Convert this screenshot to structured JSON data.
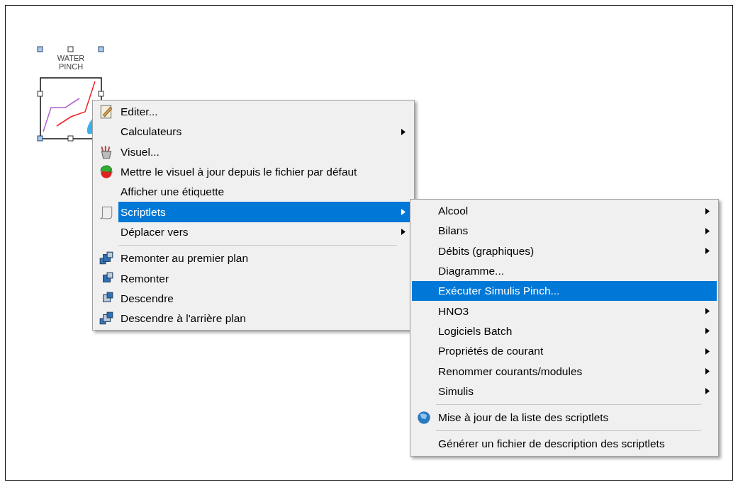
{
  "module": {
    "label": "WATER PINCH"
  },
  "context_menu": {
    "items": [
      {
        "kind": "item",
        "label": "Editer...",
        "submenu": false,
        "selected": false
      },
      {
        "kind": "item",
        "label": "Calculateurs",
        "submenu": true,
        "selected": false
      },
      {
        "kind": "item",
        "label": "Visuel...",
        "submenu": false,
        "selected": false
      },
      {
        "kind": "item",
        "label": "Mettre le visuel à jour depuis le fichier par défaut",
        "submenu": false,
        "selected": false
      },
      {
        "kind": "item",
        "label": "Afficher une étiquette",
        "submenu": false,
        "selected": false
      },
      {
        "kind": "item",
        "label": "Scriptlets",
        "submenu": true,
        "selected": true
      },
      {
        "kind": "item",
        "label": "Déplacer vers",
        "submenu": true,
        "selected": false
      },
      {
        "kind": "separator"
      },
      {
        "kind": "item",
        "label": "Remonter au premier plan",
        "submenu": false,
        "selected": false
      },
      {
        "kind": "item",
        "label": "Remonter",
        "submenu": false,
        "selected": false
      },
      {
        "kind": "item",
        "label": "Descendre",
        "submenu": false,
        "selected": false
      },
      {
        "kind": "item",
        "label": "Descendre à l'arrière plan",
        "submenu": false,
        "selected": false
      }
    ]
  },
  "submenu": {
    "items": [
      {
        "kind": "item",
        "label": "Alcool",
        "submenu": true,
        "selected": false
      },
      {
        "kind": "item",
        "label": "Bilans",
        "submenu": true,
        "selected": false
      },
      {
        "kind": "item",
        "label": "Débits (graphiques)",
        "submenu": true,
        "selected": false
      },
      {
        "kind": "item",
        "label": "Diagramme...",
        "submenu": false,
        "selected": false
      },
      {
        "kind": "item",
        "label": "Exécuter Simulis Pinch...",
        "submenu": false,
        "selected": true
      },
      {
        "kind": "item",
        "label": "HNO3",
        "submenu": true,
        "selected": false
      },
      {
        "kind": "item",
        "label": "Logiciels Batch",
        "submenu": true,
        "selected": false
      },
      {
        "kind": "item",
        "label": "Propriétés de courant",
        "submenu": true,
        "selected": false
      },
      {
        "kind": "item",
        "label": "Renommer courants/modules",
        "submenu": true,
        "selected": false
      },
      {
        "kind": "item",
        "label": "Simulis",
        "submenu": true,
        "selected": false
      },
      {
        "kind": "separator"
      },
      {
        "kind": "item",
        "label": "Mise à jour de la liste des scriptlets",
        "submenu": false,
        "selected": false
      },
      {
        "kind": "separator"
      },
      {
        "kind": "item",
        "label": "Générer un fichier de description des scriptlets",
        "submenu": false,
        "selected": false
      }
    ]
  }
}
